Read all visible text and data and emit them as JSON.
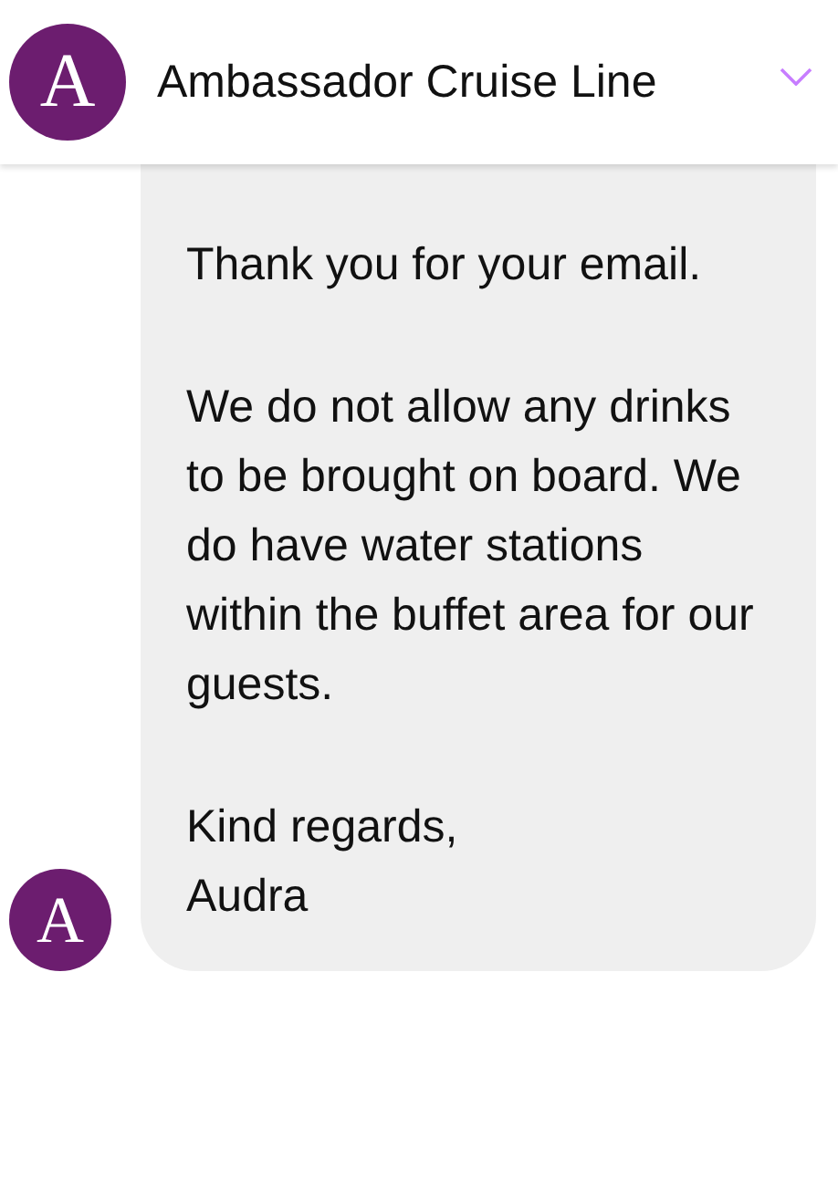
{
  "header": {
    "logo_letter": "A",
    "title": "Ambassador Cruise Line",
    "expanded": false
  },
  "message": {
    "avatar_letter": "A",
    "paragraphs": [
      "Thank you for your email.",
      "We do not allow any drinks to be brought on board.  We do have water stations within the buffet area for our guests.",
      "Kind regards,\nAudra"
    ]
  }
}
